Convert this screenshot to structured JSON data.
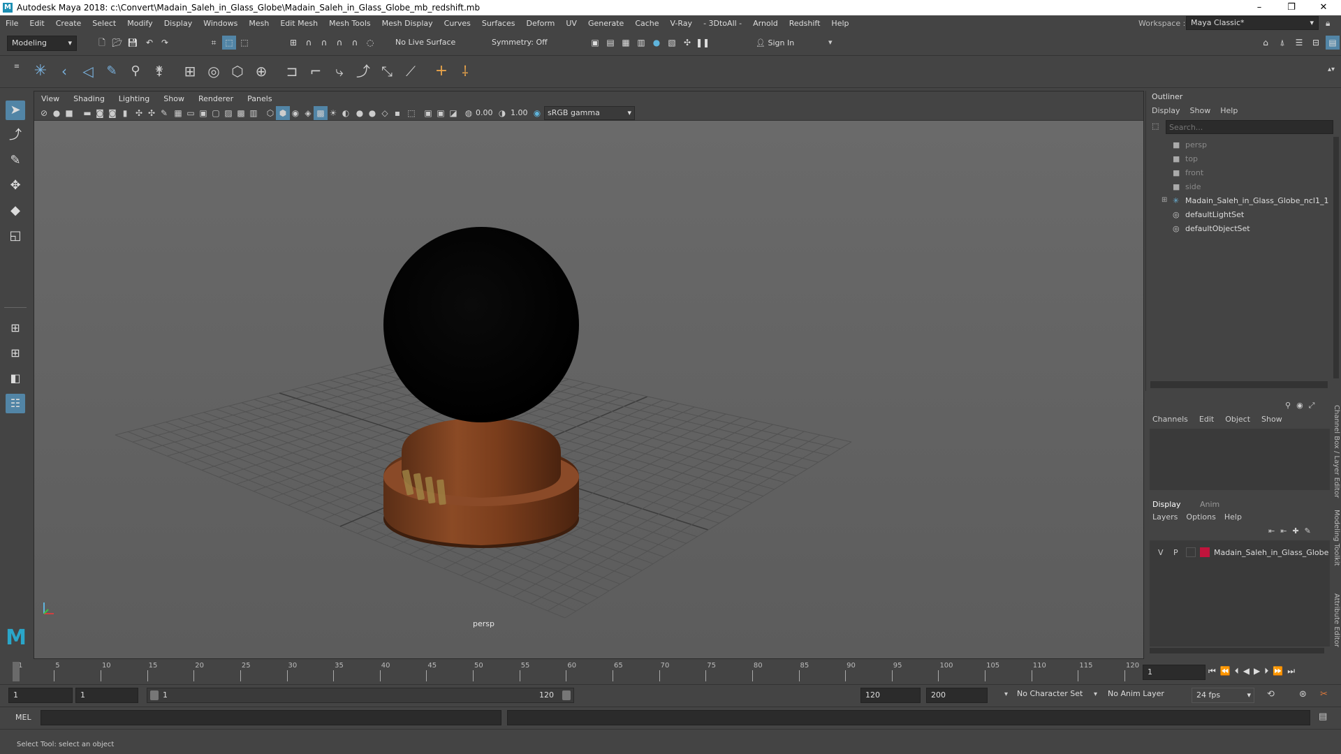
{
  "titlebar": {
    "title": "Autodesk Maya 2018: c:\\Convert\\Madain_Saleh_in_Glass_Globe\\Madain_Saleh_in_Glass_Globe_mb_redshift.mb",
    "minimize": "–",
    "maximize": "❐",
    "close": "✕"
  },
  "menubar": {
    "items": [
      "File",
      "Edit",
      "Create",
      "Select",
      "Modify",
      "Display",
      "Windows",
      "Mesh",
      "Edit Mesh",
      "Mesh Tools",
      "Mesh Display",
      "Curves",
      "Surfaces",
      "Deform",
      "UV",
      "Generate",
      "Cache",
      "V-Ray",
      "- 3DtoAll -",
      "Arnold",
      "Redshift",
      "Help"
    ],
    "workspace_label": "Workspace :",
    "workspace_value": "Maya Classic*"
  },
  "statusline": {
    "mode": "Modeling",
    "live_surface": "No Live Surface",
    "symmetry": "Symmetry: Off",
    "sign_in": "Sign In"
  },
  "viewport": {
    "menu": [
      "View",
      "Shading",
      "Lighting",
      "Show",
      "Renderer",
      "Panels"
    ],
    "exposure": "0.00",
    "gamma": "1.00",
    "color_space": "sRGB gamma",
    "camera_label": "persp"
  },
  "outliner": {
    "title": "Outliner",
    "menu": [
      "Display",
      "Show",
      "Help"
    ],
    "search_placeholder": "Search...",
    "items": [
      {
        "label": "persp",
        "icon": "camera-icon",
        "dim": true
      },
      {
        "label": "top",
        "icon": "camera-icon",
        "dim": true
      },
      {
        "label": "front",
        "icon": "camera-icon",
        "dim": true
      },
      {
        "label": "side",
        "icon": "camera-icon",
        "dim": true
      },
      {
        "label": "Madain_Saleh_in_Glass_Globe_ncl1_1",
        "icon": "group-icon",
        "dim": false
      },
      {
        "label": "defaultLightSet",
        "icon": "set-icon",
        "dim": false
      },
      {
        "label": "defaultObjectSet",
        "icon": "set-icon",
        "dim": false
      }
    ]
  },
  "channelbox": {
    "menu": [
      "Channels",
      "Edit",
      "Object",
      "Show"
    ]
  },
  "layers": {
    "tabs": [
      "Display",
      "Anim"
    ],
    "menu": [
      "Layers",
      "Options",
      "Help"
    ],
    "row": {
      "v": "V",
      "p": "P",
      "name": "Madain_Saleh_in_Glass_Globe",
      "color": "#c0143c"
    }
  },
  "side_tabs": [
    "Channel Box / Layer Editor",
    "Modeling Toolkit",
    "Attribute Editor"
  ],
  "timeline": {
    "ticks": [
      "1",
      "5",
      "10",
      "15",
      "20",
      "25",
      "30",
      "35",
      "40",
      "45",
      "50",
      "55",
      "60",
      "65",
      "70",
      "75",
      "80",
      "85",
      "90",
      "95",
      "100",
      "105",
      "110",
      "115",
      "120"
    ],
    "current_frame": "1"
  },
  "range": {
    "start": "1",
    "anim_start": "1",
    "slider_start": "1",
    "slider_end": "120",
    "anim_end": "120",
    "end": "200",
    "character_set": "No Character Set",
    "anim_layer": "No Anim Layer",
    "fps": "24 fps"
  },
  "cmdline": {
    "label": "MEL"
  },
  "helpline": {
    "text": "Select Tool: select an object"
  },
  "colors": {
    "ui_bg": "#444444",
    "viewport_bg": "#646464",
    "accent": "#5285a6",
    "layer_color": "#c0143c"
  }
}
